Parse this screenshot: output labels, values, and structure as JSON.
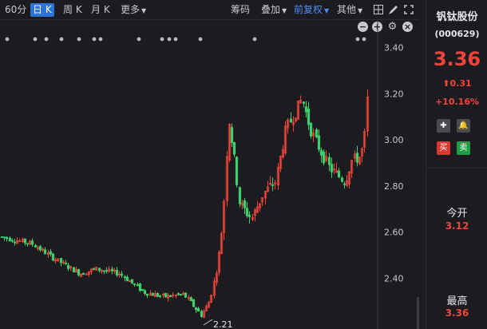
{
  "toolbar": {
    "period_60": "60分",
    "period_day": "日 K",
    "period_week": "周 K",
    "period_month": "月 K",
    "more": "更多",
    "chips": "筹码",
    "overlay": "叠加",
    "adjust": "前复权",
    "other": "其他"
  },
  "chart_data": {
    "type": "candlestick",
    "y_ticks": [
      "3.40",
      "3.20",
      "3.00",
      "2.80",
      "2.60",
      "2.40"
    ],
    "ylim": [
      2.18,
      3.52
    ],
    "low_marker_label": "2.21",
    "up_color": "#f0443b",
    "down_color": "#3dcf6b"
  },
  "stock": {
    "name": "钒钛股份",
    "code": "(000629)",
    "price": "3.36",
    "change": "0.31",
    "change_pct": "+10.16%",
    "buy_label": "买",
    "sell_label": "卖"
  },
  "stats": {
    "open_label": "今开",
    "open_value": "3.12",
    "high_label": "最高",
    "high_value": "3.36"
  }
}
